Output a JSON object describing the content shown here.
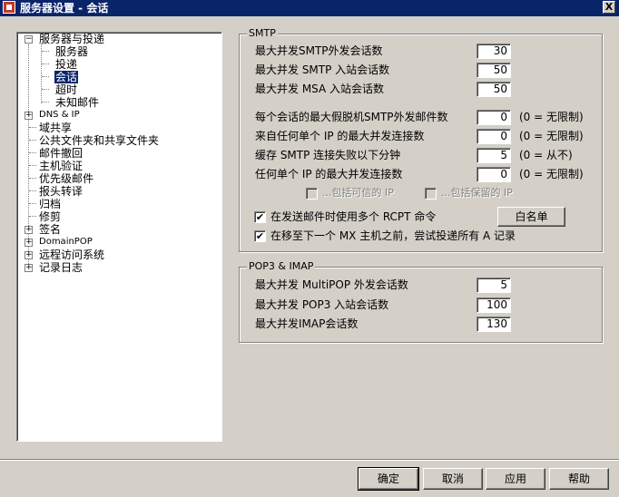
{
  "window": {
    "title": "服务器设置 - 会话",
    "close_label": "X"
  },
  "tree": {
    "items": [
      {
        "label": "服务器与投递",
        "expander": "−"
      },
      {
        "label": "服务器"
      },
      {
        "label": "投递"
      },
      {
        "label": "会话",
        "selected": true
      },
      {
        "label": "超时"
      },
      {
        "label": "未知邮件"
      },
      {
        "label": "DNS & IP",
        "expander": "+"
      },
      {
        "label": "域共享"
      },
      {
        "label": "公共文件夹和共享文件夹"
      },
      {
        "label": "邮件撤回"
      },
      {
        "label": "主机验证"
      },
      {
        "label": "优先级邮件"
      },
      {
        "label": "报头转译"
      },
      {
        "label": "归档"
      },
      {
        "label": "修剪"
      },
      {
        "label": "签名",
        "expander": "+"
      },
      {
        "label": "DomainPOP",
        "expander": "+"
      },
      {
        "label": "远程访问系统",
        "expander": "+"
      },
      {
        "label": "记录日志",
        "expander": "+"
      }
    ]
  },
  "smtp": {
    "legend": "SMTP",
    "fields": [
      {
        "label": "最大并发SMTP外发会话数",
        "value": "30"
      },
      {
        "label": "最大并发 SMTP 入站会话数",
        "value": "50"
      },
      {
        "label": "最大并发 MSA 入站会话数",
        "value": "50"
      },
      {
        "label": "每个会话的最大假脱机SMTP外发邮件数",
        "value": "0",
        "hint": "(0 = 无限制)"
      },
      {
        "label": "来自任何单个 IP 的最大并发连接数",
        "value": "0",
        "hint": "(0 = 无限制)"
      },
      {
        "label": "缓存 SMTP 连接失败以下分钟",
        "value": "5",
        "hint": "(0 = 从不)"
      },
      {
        "label": "任何单个 IP 的最大并发连接数",
        "value": "0",
        "hint": "(0 = 无限制)"
      }
    ],
    "include_trusted_ip": {
      "label": "...包括可信的 IP",
      "checked": false
    },
    "include_reserved_ip": {
      "label": "...包括保留的 IP",
      "checked": false
    },
    "multi_rcpt": {
      "label": "在发送邮件时使用多个 RCPT 命令",
      "checked": true
    },
    "try_all_a": {
      "label": "在移至下一个 MX 主机之前，尝试投递所有 A 记录",
      "checked": true
    },
    "whitelist_button": "白名单"
  },
  "pop3": {
    "legend": "POP3 & IMAP",
    "fields": [
      {
        "label": "最大并发 MultiPOP 外发会话数",
        "value": "5"
      },
      {
        "label": "最大并发 POP3 入站会话数",
        "value": "100"
      },
      {
        "label": "最大并发IMAP会话数",
        "value": "130"
      }
    ]
  },
  "buttons": {
    "ok": "确定",
    "cancel": "取消",
    "apply": "应用",
    "help": "帮助"
  },
  "check_mark": "✔"
}
